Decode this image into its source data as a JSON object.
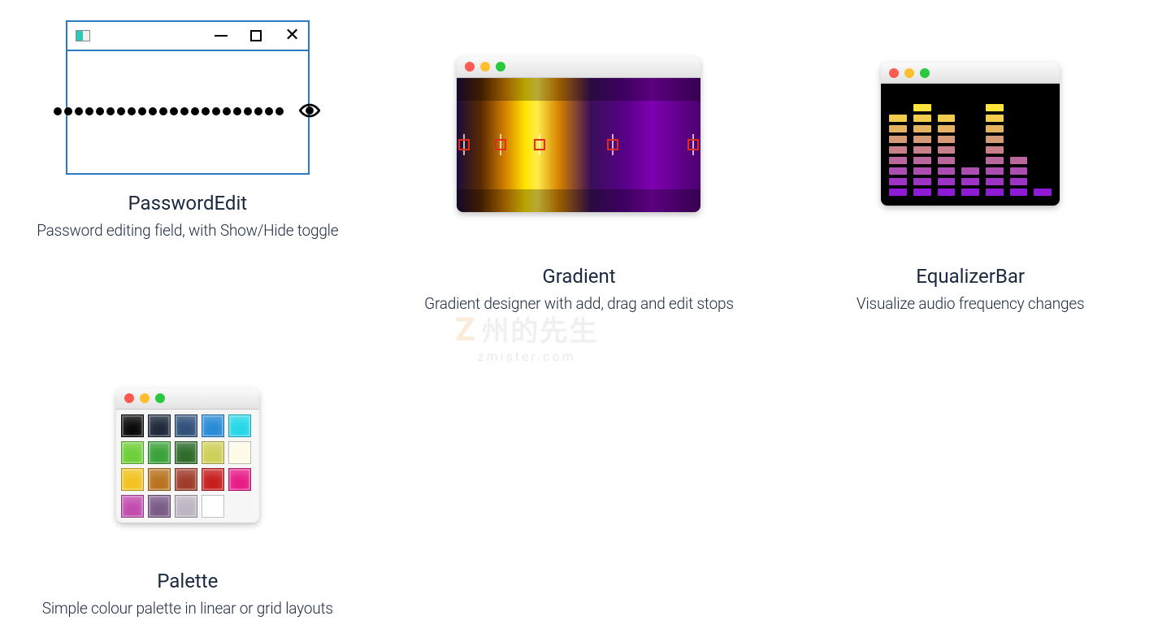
{
  "cards": {
    "passwordEdit": {
      "title": "PasswordEdit",
      "description": "Password editing field, with Show/Hide toggle",
      "dotCount": 22
    },
    "gradient": {
      "title": "Gradient",
      "description": "Gradient designer with add, drag and edit stops",
      "stops_pct": [
        3,
        18,
        34,
        64,
        97
      ]
    },
    "equalizer": {
      "title": "EqualizerBar",
      "description": "Visualize audio frequency changes",
      "columns": [
        8,
        9,
        8,
        3,
        9,
        4,
        1
      ],
      "maxSegments": 9,
      "topColor": "#ffe53b",
      "bottomColor": "#8f1bd6"
    },
    "palette": {
      "title": "Palette",
      "description": "Simple colour palette in linear or grid layouts",
      "swatches": [
        "#0a0a0a",
        "#1f2a3c",
        "#31507a",
        "#2a8bd6",
        "#27d7e8",
        "#6fcf39",
        "#3aa23a",
        "#2f6b2b",
        "#cfcf5a",
        "#fdfbe8",
        "#f2c321",
        "#b87320",
        "#a03c2b",
        "#c71f1f",
        "#e61d87",
        "#c24db0",
        "#7a5b86",
        "#bdb5c3",
        "#ffffff"
      ]
    }
  },
  "watermark": {
    "main": "州的先生",
    "sub": "zmister.com",
    "z": "Z"
  }
}
